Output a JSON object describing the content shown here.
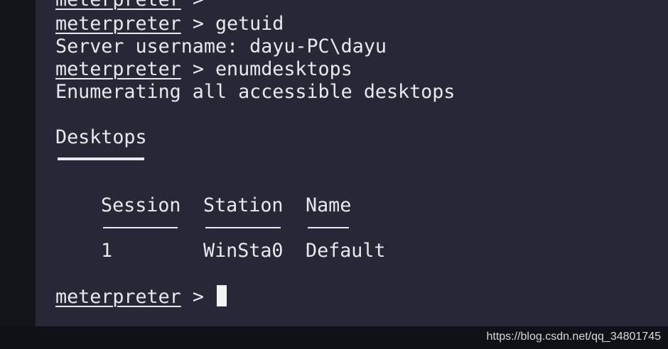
{
  "terminal": {
    "prompt": "meterpreter",
    "prompt_sep": " > ",
    "lines": {
      "top_partial_prompt": "meterpreter",
      "top_partial_sep": " >",
      "cmd_getuid": "getuid",
      "server_username": "Server username: dayu-PC\\dayu",
      "cmd_enumdesktops": "enumdesktops",
      "enumerating": "Enumerating all accessible desktops",
      "desktops_heading": "Desktops"
    },
    "table": {
      "headers": {
        "session": "Session",
        "station": "Station",
        "name": "Name"
      },
      "rows": [
        {
          "session": "1",
          "station": "WinSta0",
          "name": "Default"
        }
      ]
    },
    "final_prompt": "meterpreter",
    "final_sep": " > "
  },
  "watermark": "https://blog.csdn.net/qq_34801745",
  "colors": {
    "background": "#252935",
    "text": "#e7e9ee",
    "outer": "#111318"
  }
}
